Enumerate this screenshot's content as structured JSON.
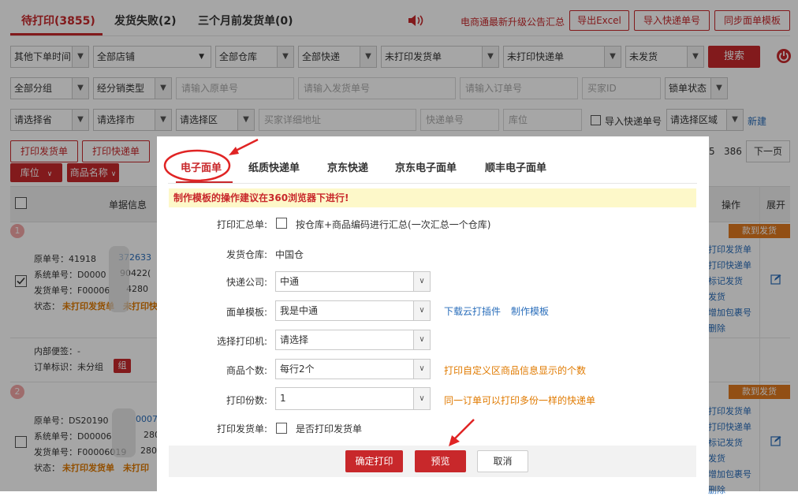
{
  "tabs": [
    {
      "label": "待打印(3855)"
    },
    {
      "label": "发货失败(2)"
    },
    {
      "label": "三个月前发货单(0)"
    }
  ],
  "announcement": "电商通最新升级公告汇总",
  "header_buttons": {
    "export": "导出Excel",
    "import_tracking": "导入快递单号",
    "sync_template": "同步面单模板"
  },
  "filters_row1": {
    "time": "其他下单时间",
    "shop": "全部店铺",
    "warehouse": "全部仓库",
    "express": "全部快递",
    "print_invoice": "未打印发货单",
    "print_express": "未打印快递单",
    "ship": "未发货",
    "search": "搜索"
  },
  "filters_row2": {
    "group": "全部分组",
    "dist_type": "经分销类型",
    "orig_no": "请输入原单号",
    "ship_no": "请输入发货单号",
    "order_no": "请输入订单号",
    "buyer": "买家ID",
    "lock": "锁单状态"
  },
  "filters_row3": {
    "province": "请选择省",
    "city": "请选择市",
    "district": "请选择区",
    "address": "买家详细地址",
    "tracking": "快递单号",
    "location": "库位",
    "import_tracking": "导入快递单号",
    "region": "请选择区域",
    "new": "新建"
  },
  "action_row": {
    "print_invoice": "打印发货单",
    "print_express": "打印快递单",
    "page_a": "5",
    "page_b": "386",
    "next": "下一页"
  },
  "sort_row": {
    "location": "库位",
    "product": "商品名称"
  },
  "table_headers": {
    "info": "单据信息",
    "ops": "操作",
    "expand": "展开"
  },
  "rows": [
    {
      "index": "1",
      "badge": "款到发货",
      "orig": "原单号：41918",
      "orig_tail": "372633",
      "sys": "系统单号：D0000",
      "sys_tail": "90422(",
      "ship": "发货单号：F00006",
      "ship_tail": "4280",
      "status_label": "状态：",
      "status1": "未打印发货单",
      "status2": "未打印快",
      "memo": "内部便签：-",
      "tag": "订单标识：未分组",
      "tag_badge": "组",
      "ops": [
        "打印发货单",
        "打印快递单",
        "标记发货",
        "发货",
        "增加包裹号",
        "删除"
      ]
    },
    {
      "index": "2",
      "badge": "款到发货",
      "orig": "原单号：DS20190",
      "orig_tail": "0007",
      "sys": "系统单号：D00006",
      "sys_tail": "280",
      "ship": "发货单号：F00006019",
      "ship_tail": "280",
      "status_label": "状态：",
      "status1": "未打印发货单",
      "status2": "未打印",
      "ops": [
        "打印发货单",
        "打印快递单",
        "标记发货",
        "发货",
        "增加包裹号",
        "删除"
      ]
    }
  ],
  "modal": {
    "tabs": [
      "电子面单",
      "纸质快递单",
      "京东快递",
      "京东电子面单",
      "顺丰电子面单"
    ],
    "notice": "制作模板的操作建议在360浏览器下进行!",
    "summary_label": "打印汇总单:",
    "summary_text": "按仓库+商品编码进行汇总(一次汇总一个仓库)",
    "warehouse_label": "发货仓库:",
    "warehouse_value": "中国仓",
    "express_label": "快递公司:",
    "express_value": "中通",
    "template_label": "面单模板:",
    "template_value": "我是中通",
    "download_plugin": "下载云打插件",
    "make_template": "制作模板",
    "printer_label": "选择打印机:",
    "printer_value": "请选择",
    "count_label": "商品个数:",
    "count_value": "每行2个",
    "count_hint": "打印自定义区商品信息显示的个数",
    "copies_label": "打印份数:",
    "copies_value": "1",
    "copies_hint": "同一订单可以打印多份一样的快递单",
    "invoice_label": "打印发货单:",
    "invoice_text": "是否打印发货单",
    "confirm": "确定打印",
    "preview": "预览",
    "cancel": "取消"
  },
  "colors": {
    "brand_red": "#c8282b",
    "link_blue": "#2a6ebb",
    "hint_orange": "#e07a00",
    "notice_bg": "#fdf8c9"
  }
}
